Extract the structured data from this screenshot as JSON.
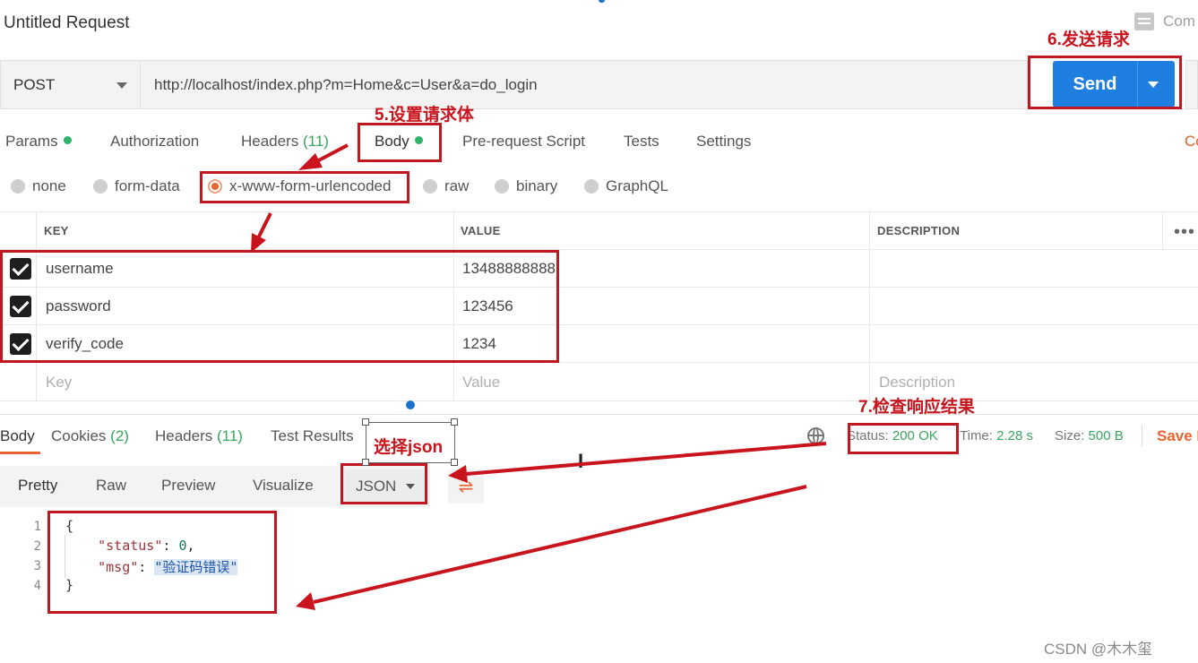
{
  "request": {
    "title": "Untitled Request",
    "comments_label": "Com",
    "method": "POST",
    "url": "http://localhost/index.php?m=Home&c=User&a=do_login",
    "send_label": "Send"
  },
  "request_tabs": {
    "params": "Params",
    "authorization": "Authorization",
    "headers": "Headers",
    "headers_count": "(11)",
    "body": "Body",
    "pre_request": "Pre-request Script",
    "tests": "Tests",
    "settings": "Settings",
    "cookies_partial": "Co"
  },
  "body_types": {
    "none": "none",
    "form_data": "form-data",
    "urlencoded": "x-www-form-urlencoded",
    "raw": "raw",
    "binary": "binary",
    "graphql": "GraphQL",
    "selected": "x-www-form-urlencoded"
  },
  "params_table": {
    "headers": [
      "KEY",
      "VALUE",
      "DESCRIPTION"
    ],
    "rows": [
      {
        "key": "username",
        "value": "13488888888",
        "checked": true
      },
      {
        "key": "password",
        "value": "123456",
        "checked": true
      },
      {
        "key": "verify_code",
        "value": "1234",
        "checked": true
      }
    ],
    "placeholder": {
      "key": "Key",
      "value": "Value",
      "description": "Description"
    }
  },
  "response_tabs": {
    "body": "Body",
    "cookies": "Cookies",
    "cookies_count": "(2)",
    "headers": "Headers",
    "headers_count": "(11)",
    "test_results": "Test Results"
  },
  "response_meta": {
    "status_label": "Status:",
    "status_value": "200 OK",
    "time_label": "Time:",
    "time_value": "2.28 s",
    "size_label": "Size:",
    "size_value": "500 B",
    "save_label": "Save R"
  },
  "view_modes": {
    "pretty": "Pretty",
    "raw": "Raw",
    "preview": "Preview",
    "visualize": "Visualize",
    "format": "JSON"
  },
  "code": {
    "line_numbers": [
      "1",
      "2",
      "3",
      "4"
    ],
    "open": "{",
    "status_key": "\"status\"",
    "status_value": "0",
    "msg_key": "\"msg\"",
    "msg_value": "\"验证码错误\"",
    "close": "}"
  },
  "annotations": {
    "step5": "5.设置请求体",
    "step6": "6.发送请求",
    "step7": "7.检查响应结果",
    "select_json": "选择json"
  },
  "watermark": "CSDN @木木玺",
  "colors": {
    "send": "#1f7fe0",
    "accent": "#e8632f",
    "green": "#3aa55e",
    "annotation": "#c01820"
  }
}
